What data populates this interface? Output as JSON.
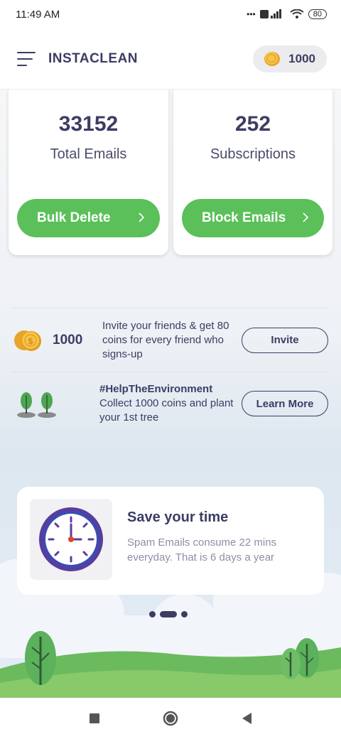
{
  "status_bar": {
    "time": "11:49 AM",
    "signal": "•••",
    "battery": "80"
  },
  "app_bar": {
    "title": "INSTACLEAN",
    "coins": "1000"
  },
  "stats": {
    "emails": {
      "value": "33152",
      "label": "Total Emails",
      "button": "Bulk Delete"
    },
    "subscriptions": {
      "value": "252",
      "label": "Subscriptions",
      "button": "Block Emails"
    }
  },
  "invite": {
    "coins": "1000",
    "text": "Invite your friends & get 80 coins for every friend who signs-up",
    "button": "Invite"
  },
  "environment": {
    "hashtag": "#HelpTheEnvironment",
    "text": "Collect 1000 coins and plant your 1st tree",
    "button": "Learn More"
  },
  "card": {
    "title": "Save your time",
    "description": "Spam Emails consume 22 mins everyday. That is 6 days a year"
  },
  "carousel": {
    "current_page": 2,
    "total_pages": 3
  },
  "colors": {
    "primary_text": "#3b3d63",
    "green": "#5bc05a",
    "gold": "#f4b63a",
    "clock_purple": "#5a3c9e"
  },
  "nav_icons": [
    "recents-square-icon",
    "home-circle-icon",
    "back-triangle-icon"
  ]
}
